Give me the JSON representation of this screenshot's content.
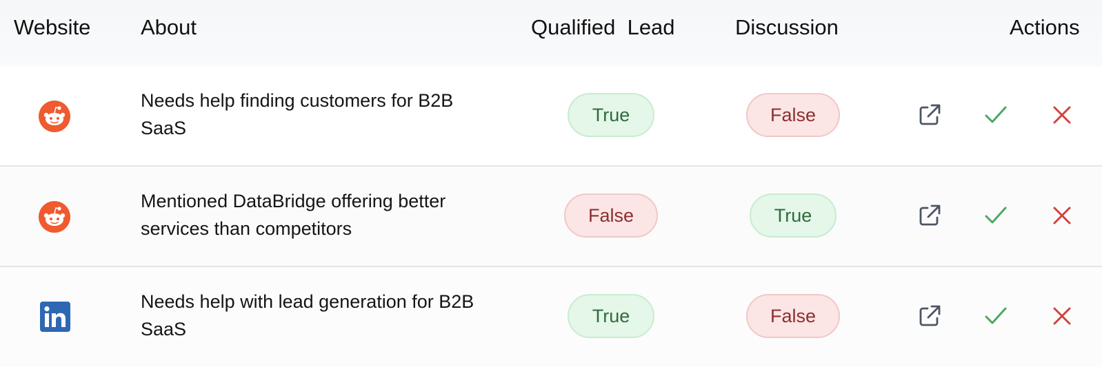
{
  "header": {
    "website": "Website",
    "about": "About",
    "qualified_lead": "Qualified  Lead",
    "discussion": "Discussion",
    "actions": "Actions"
  },
  "rows": [
    {
      "site": "reddit",
      "about": "Needs help finding customers for B2B SaaS",
      "qualified_lead": "True",
      "discussion": "False"
    },
    {
      "site": "reddit",
      "about": "Mentioned DataBridge offering better services than competitors",
      "qualified_lead": "False",
      "discussion": "True"
    },
    {
      "site": "linkedin",
      "about": "Needs help with lead generation for B2B SaaS",
      "qualified_lead": "True",
      "discussion": "False"
    }
  ],
  "icons": {
    "reddit": "reddit-icon",
    "linkedin": "linkedin-icon",
    "open": "external-link-icon",
    "approve": "check-icon",
    "reject": "close-icon"
  },
  "colors": {
    "reddit": "#ef5a2f",
    "linkedin": "#2f67b4",
    "true_text": "#2f6b3e",
    "true_bg": "#e4f7e8",
    "false_text": "#8b2f2f",
    "false_bg": "#fbe5e5",
    "approve": "#4ca760",
    "reject": "#d0423c",
    "open": "#4b5563"
  }
}
